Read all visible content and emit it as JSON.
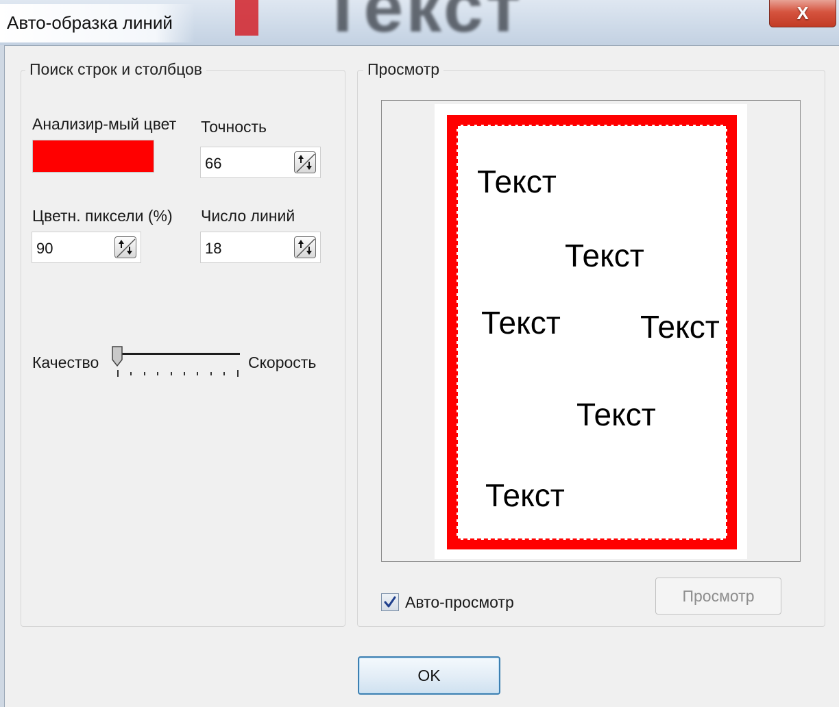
{
  "window": {
    "title": "Авто-образка линий",
    "background_word": "Текст",
    "close_label": "X"
  },
  "search_group": {
    "label": "Поиск строк и столбцов",
    "color_label": "Анализир-мый цвет",
    "color_value": "#ff0000",
    "precision_label": "Точность",
    "precision_value": "66",
    "colored_pixels_label": "Цветн. пиксели (%)",
    "colored_pixels_value": "90",
    "line_count_label": "Число линий",
    "line_count_value": "18",
    "slider_left_label": "Качество",
    "slider_right_label": "Скорость",
    "slider_position": 0
  },
  "preview_group": {
    "label": "Просмотр",
    "sample_texts": [
      "Текст",
      "Текст",
      "Текст",
      "Текст",
      "Текст",
      "Текст"
    ],
    "auto_preview_label": "Авто-просмотр",
    "auto_preview_checked": true,
    "preview_button_label": "Просмотр",
    "preview_button_enabled": false
  },
  "footer": {
    "ok_label": "OK"
  }
}
